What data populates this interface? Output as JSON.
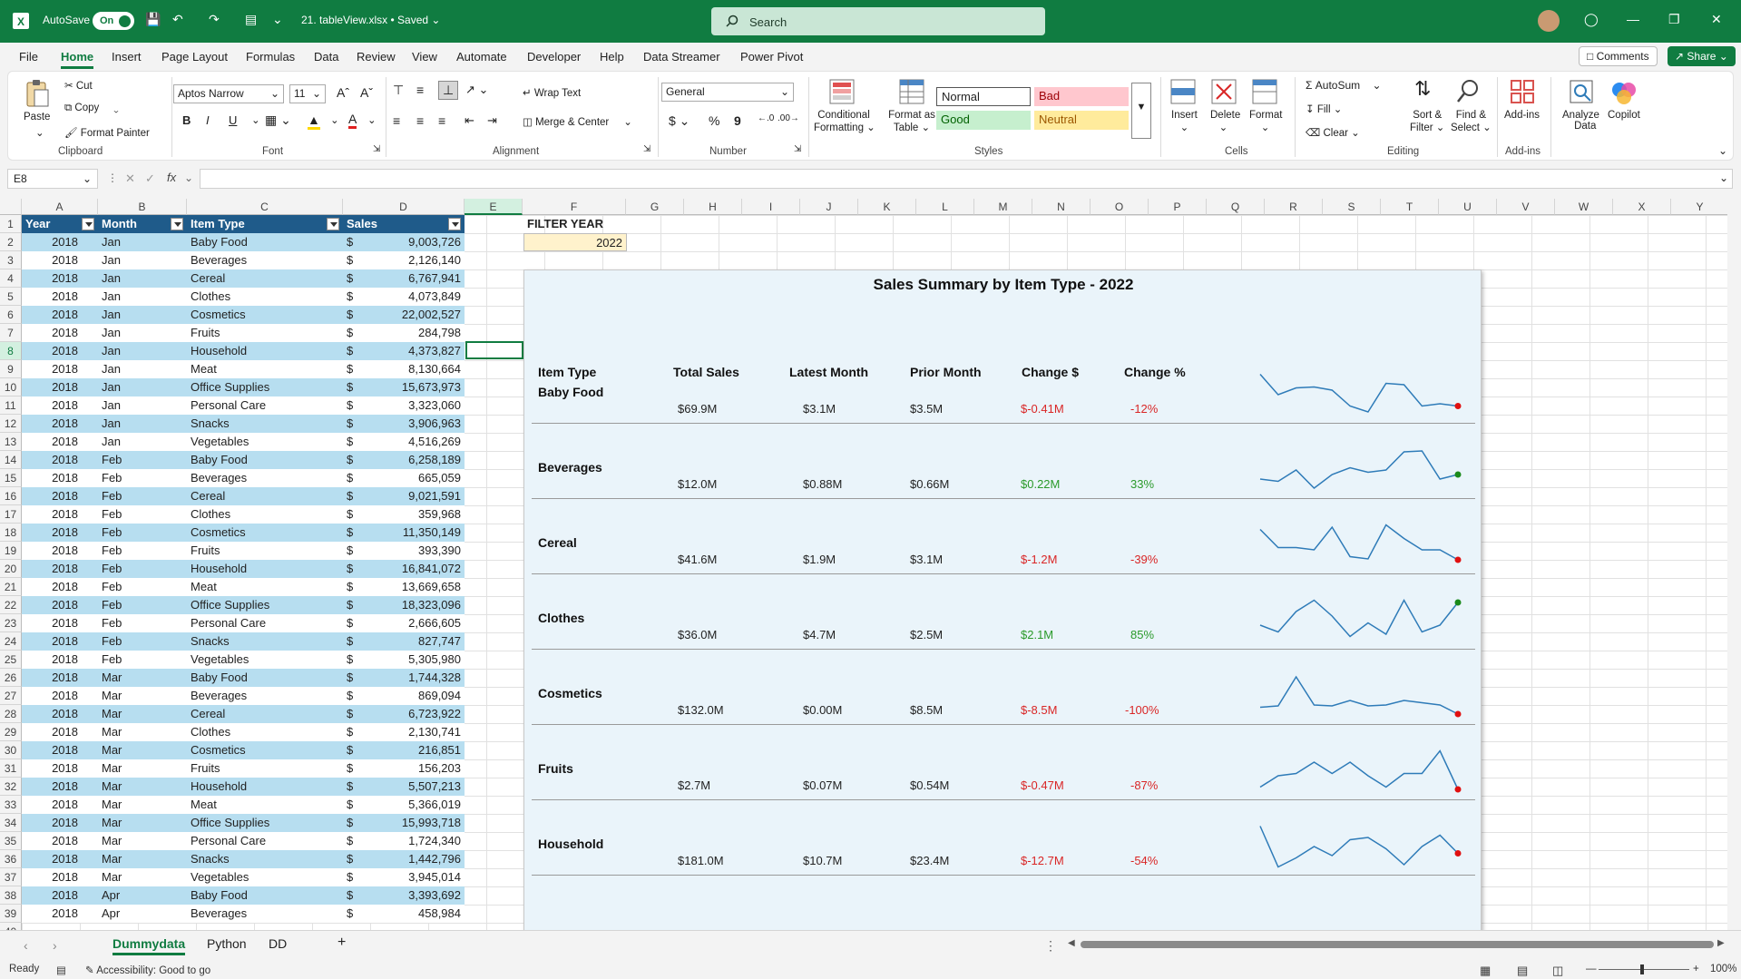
{
  "titlebar": {
    "autosave_label": "AutoSave",
    "autosave_state": "On",
    "filename": "21. tableView.xlsx",
    "saved_state": "• Saved",
    "search_placeholder": "Search"
  },
  "menu": {
    "items": [
      "File",
      "Home",
      "Insert",
      "Page Layout",
      "Formulas",
      "Data",
      "Review",
      "View",
      "Automate",
      "Developer",
      "Help",
      "Data Streamer",
      "Power Pivot"
    ],
    "active": "Home",
    "comments": "Comments",
    "share": "Share"
  },
  "ribbon": {
    "clipboard": {
      "paste": "Paste",
      "cut": "Cut",
      "copy": "Copy",
      "format_painter": "Format Painter",
      "label": "Clipboard"
    },
    "font": {
      "name": "Aptos Narrow",
      "size": "11",
      "label": "Font",
      "bold": "B",
      "italic": "I",
      "underline": "U"
    },
    "alignment": {
      "wrap_text": "Wrap Text",
      "merge_center": "Merge & Center",
      "label": "Alignment"
    },
    "number": {
      "format": "General",
      "label": "Number",
      "currency": "$",
      "percent": "%",
      "comma": "9"
    },
    "styles": {
      "conditional": "Conditional",
      "conditional2": "Formatting",
      "format_as": "Format as",
      "format_as2": "Table",
      "normal": "Normal",
      "bad": "Bad",
      "good": "Good",
      "neutral": "Neutral",
      "label": "Styles"
    },
    "cells": {
      "insert": "Insert",
      "delete": "Delete",
      "format": "Format",
      "label": "Cells"
    },
    "editing": {
      "autosum": "AutoSum",
      "fill": "Fill",
      "clear": "Clear",
      "sort": "Sort &",
      "sort2": "Filter",
      "find": "Find &",
      "find2": "Select",
      "label": "Editing"
    },
    "addins": {
      "addins": "Add-ins",
      "analyze": "Analyze",
      "analyze2": "Data",
      "copilot": "Copilot",
      "label": "Add-ins"
    }
  },
  "formula_bar": {
    "name_box": "E8",
    "fx": "fx",
    "content": ""
  },
  "columns": [
    "A",
    "B",
    "C",
    "D",
    "E",
    "F",
    "G",
    "H",
    "I",
    "J",
    "K",
    "L",
    "M",
    "N",
    "O",
    "P",
    "Q",
    "R",
    "S",
    "T",
    "U",
    "V",
    "W",
    "X",
    "Y"
  ],
  "table": {
    "headers": [
      "Year",
      "Month",
      "Item Type",
      "Sales"
    ],
    "rows": [
      [
        "2018",
        "Jan",
        "Baby Food",
        "9,003,726"
      ],
      [
        "2018",
        "Jan",
        "Beverages",
        "2,126,140"
      ],
      [
        "2018",
        "Jan",
        "Cereal",
        "6,767,941"
      ],
      [
        "2018",
        "Jan",
        "Clothes",
        "4,073,849"
      ],
      [
        "2018",
        "Jan",
        "Cosmetics",
        "22,002,527"
      ],
      [
        "2018",
        "Jan",
        "Fruits",
        "284,798"
      ],
      [
        "2018",
        "Jan",
        "Household",
        "4,373,827"
      ],
      [
        "2018",
        "Jan",
        "Meat",
        "8,130,664"
      ],
      [
        "2018",
        "Jan",
        "Office Supplies",
        "15,673,973"
      ],
      [
        "2018",
        "Jan",
        "Personal Care",
        "3,323,060"
      ],
      [
        "2018",
        "Jan",
        "Snacks",
        "3,906,963"
      ],
      [
        "2018",
        "Jan",
        "Vegetables",
        "4,516,269"
      ],
      [
        "2018",
        "Feb",
        "Baby Food",
        "6,258,189"
      ],
      [
        "2018",
        "Feb",
        "Beverages",
        "665,059"
      ],
      [
        "2018",
        "Feb",
        "Cereal",
        "9,021,591"
      ],
      [
        "2018",
        "Feb",
        "Clothes",
        "359,968"
      ],
      [
        "2018",
        "Feb",
        "Cosmetics",
        "11,350,149"
      ],
      [
        "2018",
        "Feb",
        "Fruits",
        "393,390"
      ],
      [
        "2018",
        "Feb",
        "Household",
        "16,841,072"
      ],
      [
        "2018",
        "Feb",
        "Meat",
        "13,669,658"
      ],
      [
        "2018",
        "Feb",
        "Office Supplies",
        "18,323,096"
      ],
      [
        "2018",
        "Feb",
        "Personal Care",
        "2,666,605"
      ],
      [
        "2018",
        "Feb",
        "Snacks",
        "827,747"
      ],
      [
        "2018",
        "Feb",
        "Vegetables",
        "5,305,980"
      ],
      [
        "2018",
        "Mar",
        "Baby Food",
        "1,744,328"
      ],
      [
        "2018",
        "Mar",
        "Beverages",
        "869,094"
      ],
      [
        "2018",
        "Mar",
        "Cereal",
        "6,723,922"
      ],
      [
        "2018",
        "Mar",
        "Clothes",
        "2,130,741"
      ],
      [
        "2018",
        "Mar",
        "Cosmetics",
        "216,851"
      ],
      [
        "2018",
        "Mar",
        "Fruits",
        "156,203"
      ],
      [
        "2018",
        "Mar",
        "Household",
        "5,507,213"
      ],
      [
        "2018",
        "Mar",
        "Meat",
        "5,366,019"
      ],
      [
        "2018",
        "Mar",
        "Office Supplies",
        "15,993,718"
      ],
      [
        "2018",
        "Mar",
        "Personal Care",
        "1,724,340"
      ],
      [
        "2018",
        "Mar",
        "Snacks",
        "1,442,796"
      ],
      [
        "2018",
        "Mar",
        "Vegetables",
        "3,945,014"
      ],
      [
        "2018",
        "Apr",
        "Baby Food",
        "3,393,692"
      ],
      [
        "2018",
        "Apr",
        "Beverages",
        "458,984"
      ]
    ],
    "currency_symbol": "$"
  },
  "filter": {
    "label": "FILTER YEAR",
    "value": "2022"
  },
  "summary": {
    "title": "Sales Summary by Item Type - 2022",
    "headers": [
      "Item Type",
      "Total Sales",
      "Latest Month",
      "Prior Month",
      "Change $",
      "Change %"
    ],
    "rows": [
      {
        "name": "Baby Food",
        "total": "$69.9M",
        "latest": "$3.1M",
        "prior": "$3.5M",
        "change": "$-0.41M",
        "pct": "-12%",
        "trend": "neg",
        "spark": [
          0.05,
          0.5,
          0.35,
          0.33,
          0.4,
          0.75,
          0.88,
          0.25,
          0.28,
          0.75,
          0.7,
          0.75
        ]
      },
      {
        "name": "Beverages",
        "total": "$12.0M",
        "latest": "$0.88M",
        "prior": "$0.66M",
        "change": "$0.22M",
        "pct": "33%",
        "trend": "pos",
        "spark": [
          0.7,
          0.75,
          0.5,
          0.9,
          0.6,
          0.45,
          0.55,
          0.5,
          0.1,
          0.08,
          0.7,
          0.6
        ]
      },
      {
        "name": "Cereal",
        "total": "$41.6M",
        "latest": "$1.9M",
        "prior": "$3.1M",
        "change": "$-1.2M",
        "pct": "-39%",
        "trend": "neg",
        "spark": [
          0.15,
          0.55,
          0.55,
          0.6,
          0.1,
          0.75,
          0.8,
          0.05,
          0.35,
          0.6,
          0.6,
          0.82
        ]
      },
      {
        "name": "Clothes",
        "total": "$36.0M",
        "latest": "$4.7M",
        "prior": "$2.5M",
        "change": "$2.1M",
        "pct": "85%",
        "trend": "pos",
        "spark": [
          0.6,
          0.75,
          0.3,
          0.05,
          0.4,
          0.85,
          0.55,
          0.8,
          0.05,
          0.75,
          0.6,
          0.1
        ]
      },
      {
        "name": "Cosmetics",
        "total": "$132.0M",
        "latest": "$0.00M",
        "prior": "$8.5M",
        "change": "$-8.5M",
        "pct": "-100%",
        "trend": "neg",
        "spark": [
          0.75,
          0.72,
          0.08,
          0.7,
          0.72,
          0.6,
          0.72,
          0.7,
          0.6,
          0.65,
          0.7,
          0.9
        ]
      },
      {
        "name": "Fruits",
        "total": "$2.7M",
        "latest": "$0.07M",
        "prior": "$0.54M",
        "change": "$-0.47M",
        "pct": "-87%",
        "trend": "neg",
        "spark": [
          0.85,
          0.6,
          0.55,
          0.3,
          0.55,
          0.3,
          0.6,
          0.85,
          0.55,
          0.55,
          0.05,
          0.9
        ]
      },
      {
        "name": "Household",
        "total": "$181.0M",
        "latest": "$10.7M",
        "prior": "$23.4M",
        "change": "$-12.7M",
        "pct": "-54%",
        "trend": "neg",
        "spark": [
          0.05,
          0.95,
          0.75,
          0.5,
          0.7,
          0.35,
          0.3,
          0.55,
          0.9,
          0.5,
          0.25,
          0.65
        ]
      }
    ]
  },
  "sheets": {
    "tabs": [
      "Dummydata",
      "Python",
      "DD"
    ],
    "active": "Dummydata",
    "add": "+"
  },
  "status": {
    "ready": "Ready",
    "accessibility": "Accessibility: Good to go",
    "zoom": "100%"
  },
  "colors": {
    "brand": "#107c41",
    "table_header": "#1f5b8a",
    "band": "#b7def0",
    "negative": "#d92626",
    "positive": "#2a9a2a",
    "sparkline": "#2e7bb8"
  }
}
